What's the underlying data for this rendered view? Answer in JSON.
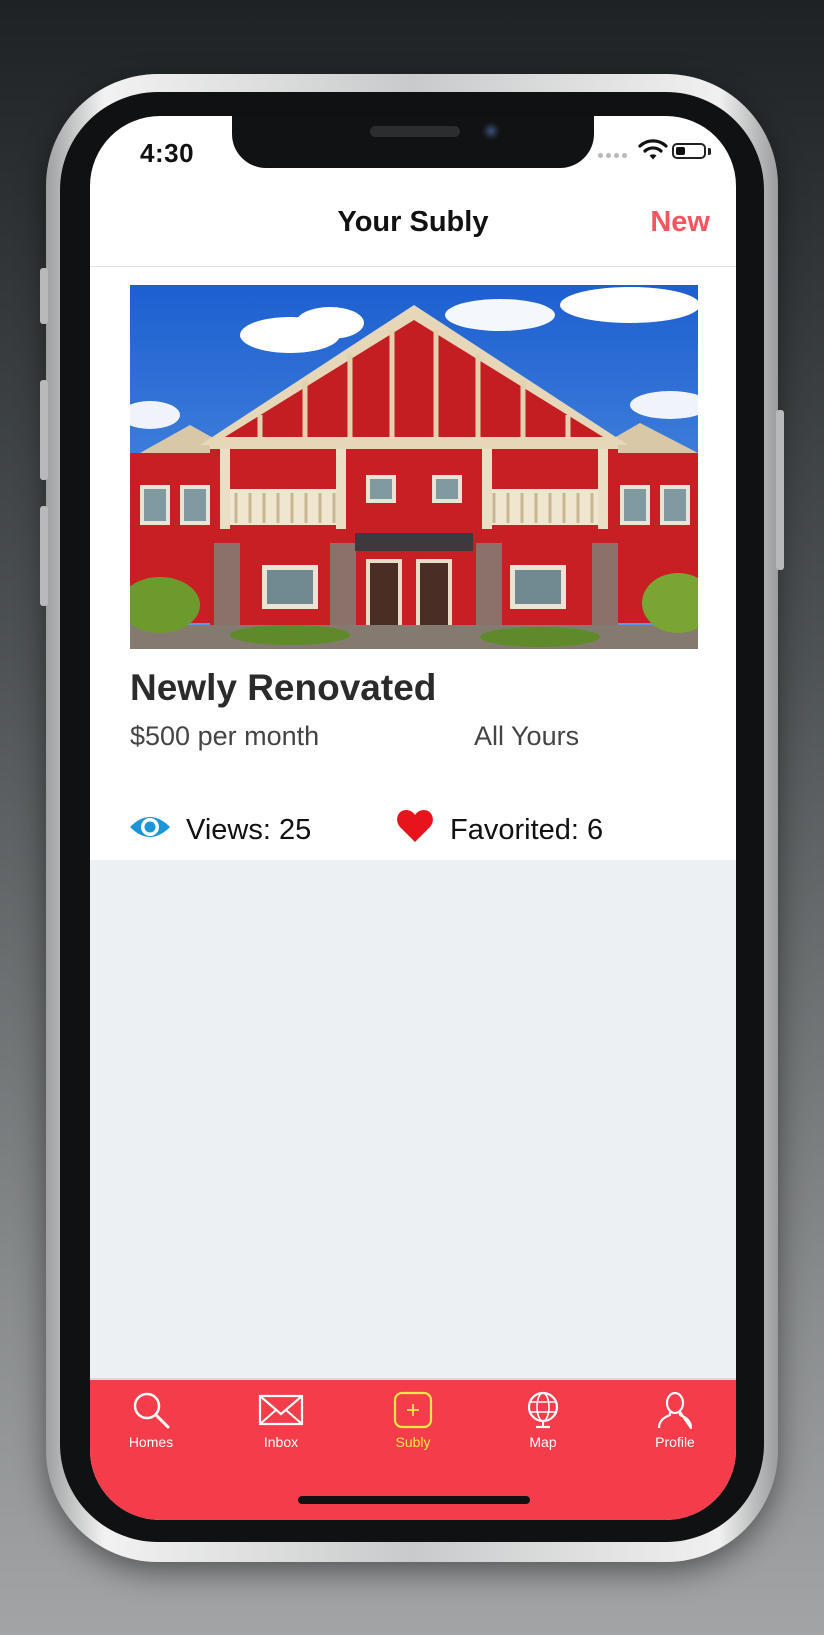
{
  "status_bar": {
    "time": "4:30",
    "battery_level": 0.35
  },
  "nav": {
    "title": "Your Subly",
    "new_label": "New"
  },
  "listing": {
    "photo_icon": "house-photo",
    "title": "Newly Renovated",
    "price": "$500 per month",
    "type": "All Yours",
    "views_label": "Views: 25",
    "favorited_label": "Favorited: 6",
    "views_icon": "eye-icon",
    "favorited_icon": "heart-icon"
  },
  "tabs": [
    {
      "label": "Homes",
      "icon": "search-icon",
      "active": false
    },
    {
      "label": "Inbox",
      "icon": "envelope-icon",
      "active": false
    },
    {
      "label": "Subly",
      "icon": "add-square-icon",
      "active": true
    },
    {
      "label": "Map",
      "icon": "globe-icon",
      "active": false
    },
    {
      "label": "Profile",
      "icon": "person-icon",
      "active": false
    }
  ],
  "colors": {
    "accent": "#f5555f",
    "tab_bar": "#f43c4b",
    "tab_active": "#f7e64a",
    "eye": "#1a95d8",
    "heart": "#e8141c",
    "background": "#ecf0f3"
  }
}
